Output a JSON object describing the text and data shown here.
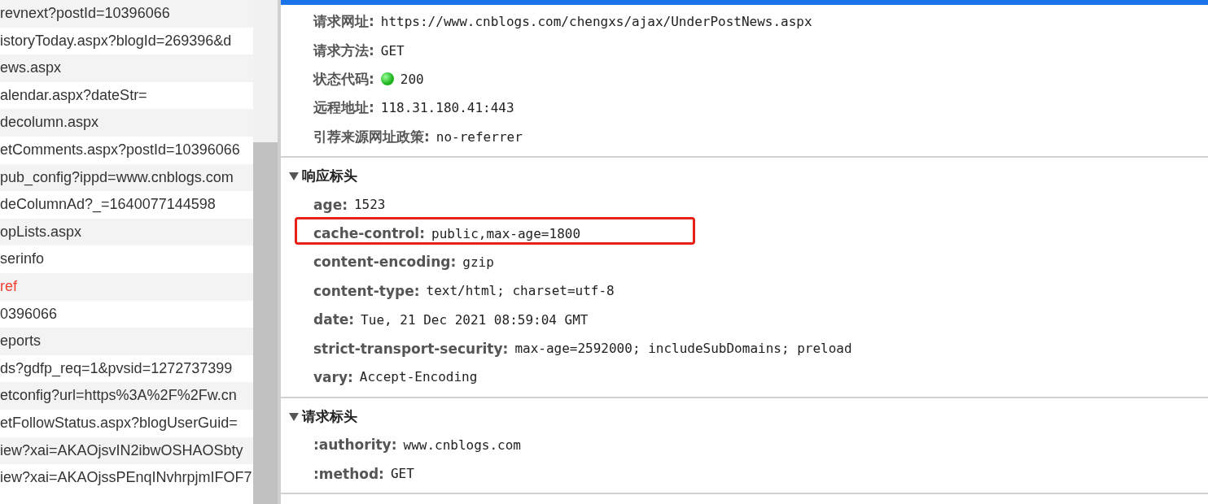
{
  "request_list": {
    "rows": [
      {
        "name": "revnext?postId=10396066",
        "error": false
      },
      {
        "name": "istoryToday.aspx?blogId=269396&d",
        "error": false
      },
      {
        "name": "ews.aspx",
        "error": false
      },
      {
        "name": "alendar.aspx?dateStr=",
        "error": false
      },
      {
        "name": "decolumn.aspx",
        "error": false
      },
      {
        "name": "etComments.aspx?postId=10396066",
        "error": false
      },
      {
        "name": "pub_config?ippd=www.cnblogs.com",
        "error": false
      },
      {
        "name": "deColumnAd?_=1640077144598",
        "error": false
      },
      {
        "name": "opLists.aspx",
        "error": false
      },
      {
        "name": "serinfo",
        "error": false
      },
      {
        "name": "ref",
        "error": true
      },
      {
        "name": "0396066",
        "error": false
      },
      {
        "name": "eports",
        "error": false
      },
      {
        "name": "ds?gdfp_req=1&pvsid=1272737399",
        "error": false
      },
      {
        "name": "etconfig?url=https%3A%2F%2Fw.cn",
        "error": false
      },
      {
        "name": "etFollowStatus.aspx?blogUserGuid=",
        "error": false
      },
      {
        "name": "iew?xai=AKAOjsvIN2ibwOSHAOSbty",
        "error": false
      },
      {
        "name": "iew?xai=AKAOjssPEnqINvhrpjmIFOF7",
        "error": false
      }
    ]
  },
  "general": [
    {
      "kind": "text",
      "label": "请求网址:",
      "value": "https://www.cnblogs.com/chengxs/ajax/UnderPostNews.aspx"
    },
    {
      "kind": "text",
      "label": "请求方法:",
      "value": "GET"
    },
    {
      "kind": "status",
      "label": "状态代码:",
      "value": "200"
    },
    {
      "kind": "text",
      "label": "远程地址:",
      "value": "118.31.180.41:443"
    },
    {
      "kind": "text",
      "label": "引荐来源网址政策:",
      "value": "no-referrer"
    }
  ],
  "sections": [
    {
      "title": "响应标头",
      "expanded": true,
      "headers": [
        {
          "name": "age:",
          "value": "1523",
          "highlighted": false
        },
        {
          "name": "cache-control:",
          "value": "public,max-age=1800",
          "highlighted": true
        },
        {
          "name": "content-encoding:",
          "value": "gzip",
          "highlighted": false
        },
        {
          "name": "content-type:",
          "value": "text/html; charset=utf-8",
          "highlighted": false
        },
        {
          "name": "date:",
          "value": "Tue, 21 Dec 2021 08:59:04 GMT",
          "highlighted": false
        },
        {
          "name": "strict-transport-security:",
          "value": "max-age=2592000; includeSubDomains; preload",
          "highlighted": false
        },
        {
          "name": "vary:",
          "value": "Accept-Encoding",
          "highlighted": false
        }
      ]
    },
    {
      "title": "请求标头",
      "expanded": true,
      "headers": [
        {
          "name": ":authority:",
          "value": "www.cnblogs.com",
          "highlighted": false
        },
        {
          "name": ":method:",
          "value": "GET",
          "highlighted": false
        }
      ]
    }
  ]
}
